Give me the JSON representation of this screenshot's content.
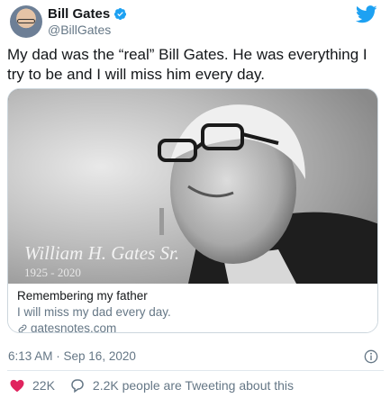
{
  "author": {
    "display_name": "Bill Gates",
    "handle": "@BillGates"
  },
  "tweet": {
    "text": "My dad was the  “real”  Bill Gates. He was everything I try to be and I will miss him every day."
  },
  "card": {
    "image_caption_name": "William H. Gates Sr.",
    "image_caption_years": "1925 - 2020",
    "title": "Remembering my father",
    "description": "I will miss my dad every day.",
    "domain": "gatesnotes.com"
  },
  "meta": {
    "timestamp": "6:13 AM · Sep 16, 2020"
  },
  "actions": {
    "likes": "22K",
    "conversation": "2.2K people are Tweeting about this"
  },
  "colors": {
    "twitter_blue": "#1da1f2",
    "heart_red": "#e0245e",
    "secondary_text": "#657786"
  }
}
